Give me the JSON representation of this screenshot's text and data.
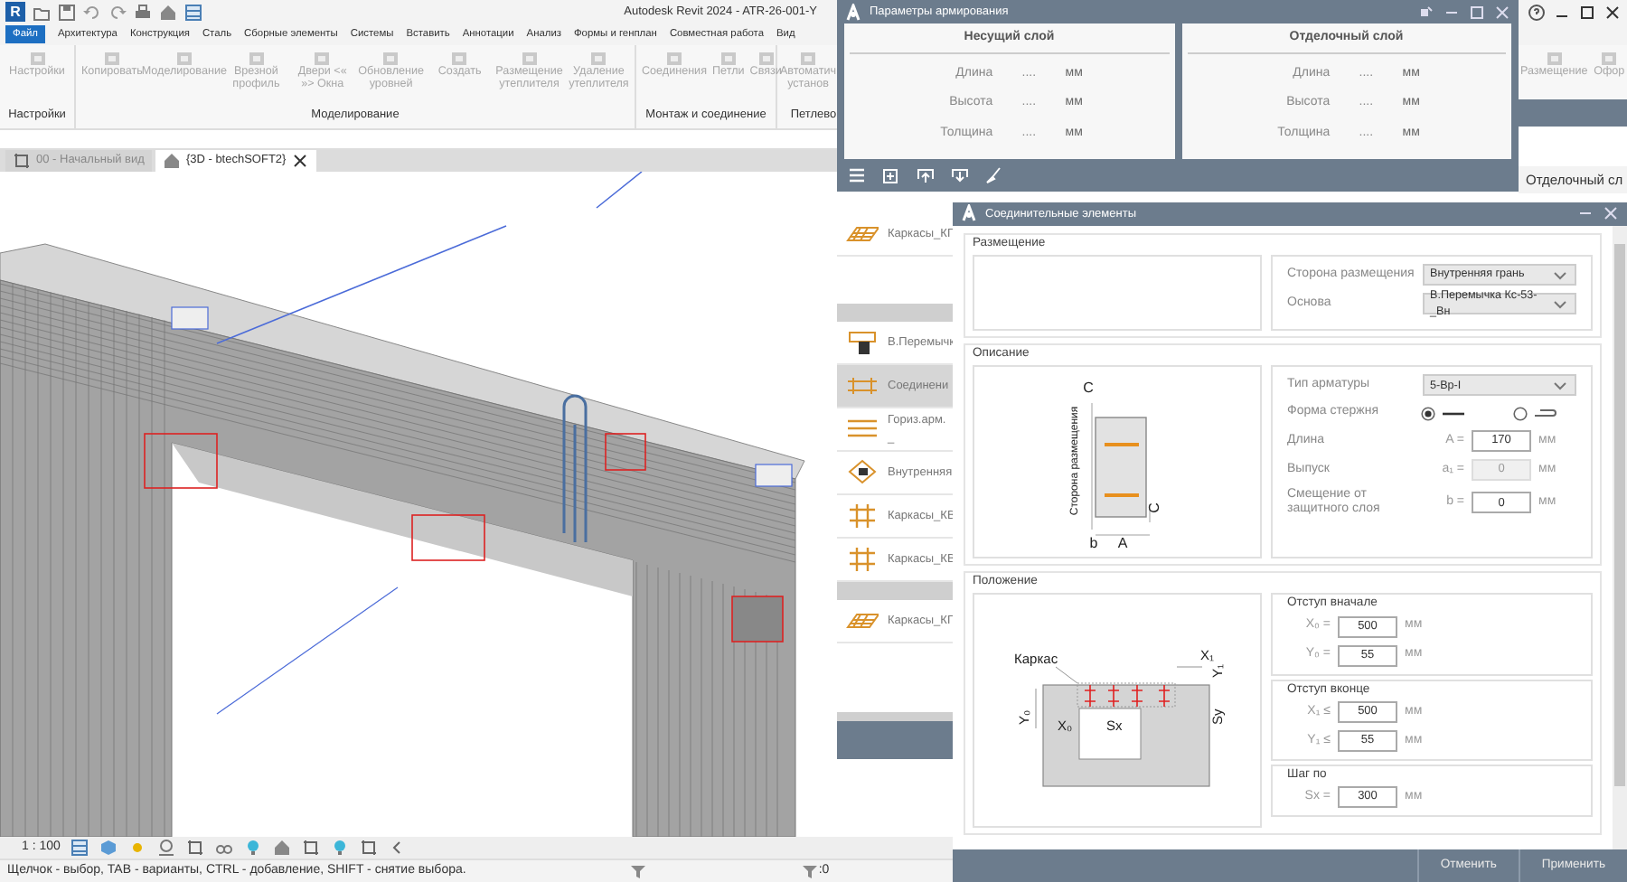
{
  "revit": {
    "logo": "R",
    "title": "Autodesk Revit 2024 - ATR-26-001-Y",
    "file_tab": "Файл",
    "menu": [
      "Архитектура",
      "Конструкция",
      "Сталь",
      "Сборные элементы",
      "Системы",
      "Вставить",
      "Аннотации",
      "Анализ",
      "Формы и генплан",
      "Совместная работа",
      "Вид"
    ],
    "ribbon": {
      "disabled": true,
      "panels": [
        {
          "title": "Настройки",
          "tools": [
            "Настройки"
          ]
        },
        {
          "title": "Моделирование",
          "tools": [
            "Копировать",
            "Моделирование",
            "Врезной профиль",
            "Двери <« »> Окна",
            "Обновление уровней",
            "Создать",
            "Размещение утеплителя",
            "Удаление утеплителя"
          ]
        },
        {
          "title": "Монтаж и соединение",
          "tools": [
            "Соединения",
            "Петли",
            "Связи"
          ]
        },
        {
          "title": "Петлево",
          "tools": [
            "Автоматич установ"
          ]
        }
      ],
      "right_tools": [
        "Размещение",
        "Офор"
      ]
    },
    "view_tabs": [
      {
        "label": "00 - Начальный вид",
        "selected": false
      },
      {
        "label": "{3D - btechSOFT2}",
        "selected": true
      }
    ],
    "scale": "1 : 100",
    "status": "Щелчок - выбор, TAB - варианты, CTRL - добавление, SHIFT - снятие выбора.",
    "selection_count": ":0"
  },
  "back_panel": {
    "heading": "Отделочный сл"
  },
  "params_window": {
    "title": "Параметры армирования",
    "layers": [
      {
        "title": "Несущий слой",
        "rows": [
          {
            "label": "Длина",
            "value": "....",
            "unit": "мм"
          },
          {
            "label": "Высота",
            "value": "....",
            "unit": "мм"
          },
          {
            "label": "Толщина",
            "value": "....",
            "unit": "мм"
          }
        ]
      },
      {
        "title": "Отделочный слой",
        "rows": [
          {
            "label": "Длина",
            "value": "....",
            "unit": "мм"
          },
          {
            "label": "Высота",
            "value": "....",
            "unit": "мм"
          },
          {
            "label": "Толщина",
            "value": "....",
            "unit": "мм"
          }
        ]
      }
    ],
    "groups": [
      {
        "items": [
          {
            "label": "Каркасы_КГ",
            "kind": "mesh",
            "selected": false
          }
        ]
      },
      {
        "items": [
          {
            "label": "В.Перемычк",
            "kind": "lintel",
            "selected": false
          },
          {
            "label": "Соединени",
            "kind": "connector",
            "selected": true
          },
          {
            "label": "Гориз.арм. _",
            "kind": "bars",
            "selected": false
          },
          {
            "label": "Внутренняя",
            "kind": "ring",
            "selected": false
          },
          {
            "label": "Каркасы_КВ",
            "kind": "cage",
            "selected": false
          },
          {
            "label": "Каркасы_КВ",
            "kind": "cage",
            "selected": false
          }
        ]
      },
      {
        "items": [
          {
            "label": "Каркасы_КГ",
            "kind": "mesh",
            "selected": false
          }
        ]
      }
    ]
  },
  "connect_window": {
    "title": "Соединительные элементы",
    "placement": {
      "title": "Размещение",
      "fields": [
        {
          "label": "Сторона размещения",
          "value": "Внутренняя грань"
        },
        {
          "label": "Основа",
          "value": "В.Перемычка Кс-53-_Вн"
        }
      ]
    },
    "description": {
      "title": "Описание",
      "diagram_labels": [
        "С",
        "Сторона размещения",
        "b",
        "A",
        "С"
      ],
      "rebar_type": {
        "label": "Тип арматуры",
        "value": "5-Вр-I"
      },
      "rod_shape": {
        "label": "Форма стержня",
        "options": [
          {
            "kind": "straight",
            "selected": true
          },
          {
            "kind": "hook",
            "selected": false
          }
        ]
      },
      "fields": [
        {
          "label": "Длина",
          "symbol": "A =",
          "value": "170",
          "unit": "мм",
          "disabled": false
        },
        {
          "label": "Выпуск",
          "symbol": "a₁ =",
          "value": "0",
          "unit": "мм",
          "disabled": true
        },
        {
          "label": "Смещение от защитного слоя",
          "symbol": "b =",
          "value": "0",
          "unit": "мм",
          "disabled": false
        }
      ]
    },
    "position": {
      "title": "Положение",
      "diagram_labels": [
        "Каркас",
        "X₁",
        "Y₁",
        "Y₀",
        "X₀",
        "Sx",
        "Sy"
      ],
      "groups": [
        {
          "title": "Отступ вначале",
          "rows": [
            {
              "symbol": "X₀ =",
              "value": "500",
              "unit": "мм"
            },
            {
              "symbol": "Y₀ =",
              "value": "55",
              "unit": "мм"
            }
          ]
        },
        {
          "title": "Отступ вконце",
          "rows": [
            {
              "symbol": "X₁ ≤",
              "value": "500",
              "unit": "мм"
            },
            {
              "symbol": "Y₁ ≤",
              "value": "55",
              "unit": "мм"
            }
          ]
        },
        {
          "title": "Шаг по",
          "rows": [
            {
              "symbol": "Sx =",
              "value": "300",
              "unit": "мм"
            }
          ]
        }
      ]
    },
    "buttons": [
      "Отменить",
      "Применить"
    ]
  }
}
